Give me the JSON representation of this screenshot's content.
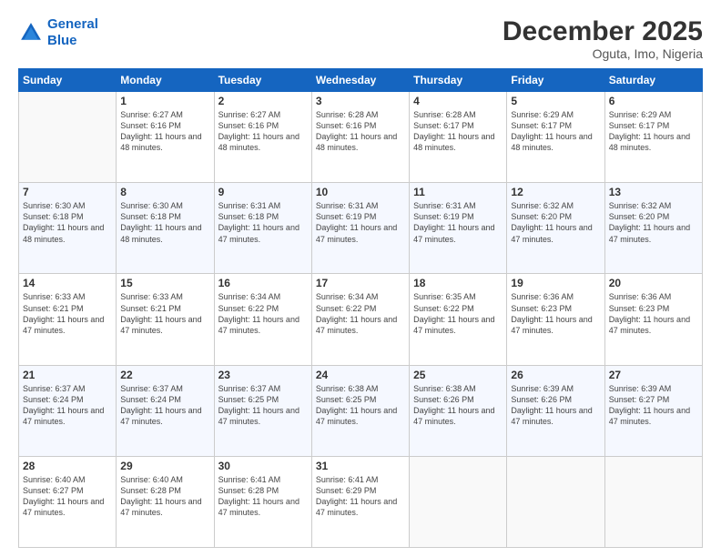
{
  "logo": {
    "line1": "General",
    "line2": "Blue"
  },
  "title": "December 2025",
  "subtitle": "Oguta, Imo, Nigeria",
  "weekdays": [
    "Sunday",
    "Monday",
    "Tuesday",
    "Wednesday",
    "Thursday",
    "Friday",
    "Saturday"
  ],
  "weeks": [
    [
      {
        "day": "",
        "sunrise": "",
        "sunset": "",
        "daylight": ""
      },
      {
        "day": "1",
        "sunrise": "Sunrise: 6:27 AM",
        "sunset": "Sunset: 6:16 PM",
        "daylight": "Daylight: 11 hours and 48 minutes."
      },
      {
        "day": "2",
        "sunrise": "Sunrise: 6:27 AM",
        "sunset": "Sunset: 6:16 PM",
        "daylight": "Daylight: 11 hours and 48 minutes."
      },
      {
        "day": "3",
        "sunrise": "Sunrise: 6:28 AM",
        "sunset": "Sunset: 6:16 PM",
        "daylight": "Daylight: 11 hours and 48 minutes."
      },
      {
        "day": "4",
        "sunrise": "Sunrise: 6:28 AM",
        "sunset": "Sunset: 6:17 PM",
        "daylight": "Daylight: 11 hours and 48 minutes."
      },
      {
        "day": "5",
        "sunrise": "Sunrise: 6:29 AM",
        "sunset": "Sunset: 6:17 PM",
        "daylight": "Daylight: 11 hours and 48 minutes."
      },
      {
        "day": "6",
        "sunrise": "Sunrise: 6:29 AM",
        "sunset": "Sunset: 6:17 PM",
        "daylight": "Daylight: 11 hours and 48 minutes."
      }
    ],
    [
      {
        "day": "7",
        "sunrise": "Sunrise: 6:30 AM",
        "sunset": "Sunset: 6:18 PM",
        "daylight": "Daylight: 11 hours and 48 minutes."
      },
      {
        "day": "8",
        "sunrise": "Sunrise: 6:30 AM",
        "sunset": "Sunset: 6:18 PM",
        "daylight": "Daylight: 11 hours and 48 minutes."
      },
      {
        "day": "9",
        "sunrise": "Sunrise: 6:31 AM",
        "sunset": "Sunset: 6:18 PM",
        "daylight": "Daylight: 11 hours and 47 minutes."
      },
      {
        "day": "10",
        "sunrise": "Sunrise: 6:31 AM",
        "sunset": "Sunset: 6:19 PM",
        "daylight": "Daylight: 11 hours and 47 minutes."
      },
      {
        "day": "11",
        "sunrise": "Sunrise: 6:31 AM",
        "sunset": "Sunset: 6:19 PM",
        "daylight": "Daylight: 11 hours and 47 minutes."
      },
      {
        "day": "12",
        "sunrise": "Sunrise: 6:32 AM",
        "sunset": "Sunset: 6:20 PM",
        "daylight": "Daylight: 11 hours and 47 minutes."
      },
      {
        "day": "13",
        "sunrise": "Sunrise: 6:32 AM",
        "sunset": "Sunset: 6:20 PM",
        "daylight": "Daylight: 11 hours and 47 minutes."
      }
    ],
    [
      {
        "day": "14",
        "sunrise": "Sunrise: 6:33 AM",
        "sunset": "Sunset: 6:21 PM",
        "daylight": "Daylight: 11 hours and 47 minutes."
      },
      {
        "day": "15",
        "sunrise": "Sunrise: 6:33 AM",
        "sunset": "Sunset: 6:21 PM",
        "daylight": "Daylight: 11 hours and 47 minutes."
      },
      {
        "day": "16",
        "sunrise": "Sunrise: 6:34 AM",
        "sunset": "Sunset: 6:22 PM",
        "daylight": "Daylight: 11 hours and 47 minutes."
      },
      {
        "day": "17",
        "sunrise": "Sunrise: 6:34 AM",
        "sunset": "Sunset: 6:22 PM",
        "daylight": "Daylight: 11 hours and 47 minutes."
      },
      {
        "day": "18",
        "sunrise": "Sunrise: 6:35 AM",
        "sunset": "Sunset: 6:22 PM",
        "daylight": "Daylight: 11 hours and 47 minutes."
      },
      {
        "day": "19",
        "sunrise": "Sunrise: 6:36 AM",
        "sunset": "Sunset: 6:23 PM",
        "daylight": "Daylight: 11 hours and 47 minutes."
      },
      {
        "day": "20",
        "sunrise": "Sunrise: 6:36 AM",
        "sunset": "Sunset: 6:23 PM",
        "daylight": "Daylight: 11 hours and 47 minutes."
      }
    ],
    [
      {
        "day": "21",
        "sunrise": "Sunrise: 6:37 AM",
        "sunset": "Sunset: 6:24 PM",
        "daylight": "Daylight: 11 hours and 47 minutes."
      },
      {
        "day": "22",
        "sunrise": "Sunrise: 6:37 AM",
        "sunset": "Sunset: 6:24 PM",
        "daylight": "Daylight: 11 hours and 47 minutes."
      },
      {
        "day": "23",
        "sunrise": "Sunrise: 6:37 AM",
        "sunset": "Sunset: 6:25 PM",
        "daylight": "Daylight: 11 hours and 47 minutes."
      },
      {
        "day": "24",
        "sunrise": "Sunrise: 6:38 AM",
        "sunset": "Sunset: 6:25 PM",
        "daylight": "Daylight: 11 hours and 47 minutes."
      },
      {
        "day": "25",
        "sunrise": "Sunrise: 6:38 AM",
        "sunset": "Sunset: 6:26 PM",
        "daylight": "Daylight: 11 hours and 47 minutes."
      },
      {
        "day": "26",
        "sunrise": "Sunrise: 6:39 AM",
        "sunset": "Sunset: 6:26 PM",
        "daylight": "Daylight: 11 hours and 47 minutes."
      },
      {
        "day": "27",
        "sunrise": "Sunrise: 6:39 AM",
        "sunset": "Sunset: 6:27 PM",
        "daylight": "Daylight: 11 hours and 47 minutes."
      }
    ],
    [
      {
        "day": "28",
        "sunrise": "Sunrise: 6:40 AM",
        "sunset": "Sunset: 6:27 PM",
        "daylight": "Daylight: 11 hours and 47 minutes."
      },
      {
        "day": "29",
        "sunrise": "Sunrise: 6:40 AM",
        "sunset": "Sunset: 6:28 PM",
        "daylight": "Daylight: 11 hours and 47 minutes."
      },
      {
        "day": "30",
        "sunrise": "Sunrise: 6:41 AM",
        "sunset": "Sunset: 6:28 PM",
        "daylight": "Daylight: 11 hours and 47 minutes."
      },
      {
        "day": "31",
        "sunrise": "Sunrise: 6:41 AM",
        "sunset": "Sunset: 6:29 PM",
        "daylight": "Daylight: 11 hours and 47 minutes."
      },
      {
        "day": "",
        "sunrise": "",
        "sunset": "",
        "daylight": ""
      },
      {
        "day": "",
        "sunrise": "",
        "sunset": "",
        "daylight": ""
      },
      {
        "day": "",
        "sunrise": "",
        "sunset": "",
        "daylight": ""
      }
    ]
  ]
}
